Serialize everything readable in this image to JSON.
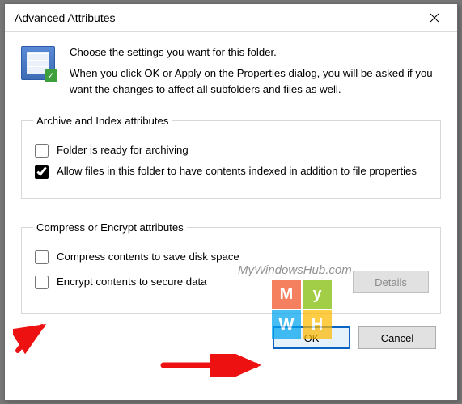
{
  "window": {
    "title": "Advanced Attributes"
  },
  "intro": {
    "line1": "Choose the settings you want for this folder.",
    "line2": "When you click OK or Apply on the Properties dialog, you will be asked if you want the changes to affect all subfolders and files as well."
  },
  "group1": {
    "legend": "Archive and Index attributes",
    "opt1": {
      "label": "Folder is ready for archiving",
      "checked": false
    },
    "opt2": {
      "label": "Allow files in this folder to have contents indexed in addition to file properties",
      "checked": true
    }
  },
  "group2": {
    "legend": "Compress or Encrypt attributes",
    "opt1": {
      "label": "Compress contents to save disk space",
      "checked": false
    },
    "opt2": {
      "label": "Encrypt contents to secure data",
      "checked": false
    },
    "details": "Details"
  },
  "buttons": {
    "ok": "OK",
    "cancel": "Cancel"
  },
  "watermark": {
    "text": "MyWindowsHub.com",
    "logo_letters": [
      "M",
      "y",
      "W",
      "H"
    ]
  }
}
